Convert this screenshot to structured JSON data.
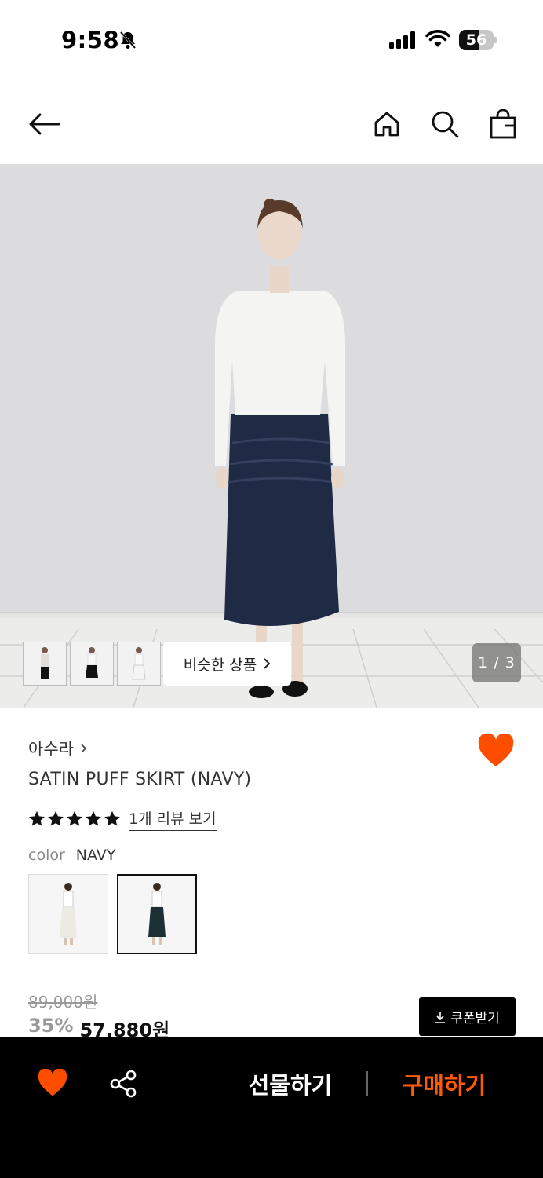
{
  "status_bar": {
    "time": "9:58",
    "battery": "56",
    "battery_level": 0.56
  },
  "header": {
    "icons": [
      "back-arrow-icon",
      "home-icon",
      "search-icon",
      "shopping-bag-icon"
    ]
  },
  "gallery": {
    "similar_button": "비슷한 상품",
    "counter": "1 / 3"
  },
  "product": {
    "brand": "아수라",
    "title": "SATIN PUFF SKIRT (NAVY)",
    "rating_stars": 5,
    "review_link": "1개 리뷰 보기",
    "color_label": "color",
    "color_value": "NAVY",
    "original_price": "89,000원",
    "discount": "35%",
    "sale_price": "57,880원",
    "coupon_button": "쿠폰받기"
  },
  "bottom_bar": {
    "gift_button": "선물하기",
    "buy_button": "구매하기"
  },
  "colors": {
    "accent": "#ff5a00",
    "heart": "#ff4d00",
    "black": "#000000"
  }
}
